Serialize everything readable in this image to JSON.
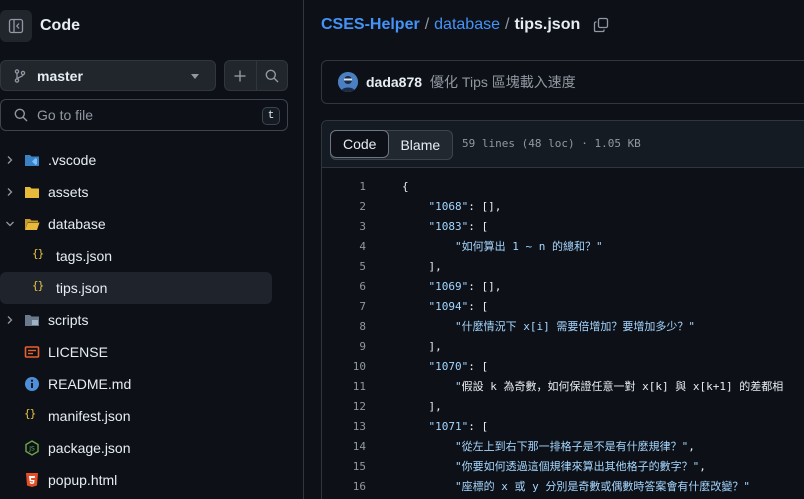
{
  "sidebar": {
    "title": "Code",
    "branch": "master",
    "goto_placeholder": "Go to file",
    "shortcut_key": "t",
    "items": [
      {
        "label": ".vscode",
        "type": "folder",
        "expanded": false,
        "indent": 0,
        "icon": "vscode-folder-icon"
      },
      {
        "label": "assets",
        "type": "folder",
        "expanded": false,
        "indent": 0,
        "icon": "folder-icon"
      },
      {
        "label": "database",
        "type": "folder",
        "expanded": true,
        "indent": 0,
        "icon": "folder-icon"
      },
      {
        "label": "tags.json",
        "type": "file",
        "indent": 1,
        "icon": "json-icon"
      },
      {
        "label": "tips.json",
        "type": "file",
        "indent": 1,
        "icon": "json-icon",
        "selected": true
      },
      {
        "label": "scripts",
        "type": "folder",
        "expanded": false,
        "indent": 0,
        "icon": "scripts-folder-icon"
      },
      {
        "label": "LICENSE",
        "type": "file",
        "indent": 0,
        "icon": "license-icon"
      },
      {
        "label": "README.md",
        "type": "file",
        "indent": 0,
        "icon": "info-icon"
      },
      {
        "label": "manifest.json",
        "type": "file",
        "indent": 0,
        "icon": "json-icon"
      },
      {
        "label": "package.json",
        "type": "file",
        "indent": 0,
        "icon": "node-icon"
      },
      {
        "label": "popup.html",
        "type": "file",
        "indent": 0,
        "icon": "html-icon"
      }
    ]
  },
  "breadcrumb": {
    "repo": "CSES-Helper",
    "folder": "database",
    "file": "tips.json",
    "sep": "/"
  },
  "commit": {
    "author": "dada878",
    "message": "優化 Tips 區塊載入速度"
  },
  "file_view": {
    "tabs": [
      "Code",
      "Blame"
    ],
    "active_tab": "Code",
    "meta": "59 lines (48 loc) · 1.05 KB"
  },
  "code_lines": [
    {
      "n": "1",
      "text": "{"
    },
    {
      "n": "2",
      "text": "    \"1068\": [],"
    },
    {
      "n": "3",
      "text": "    \"1083\": ["
    },
    {
      "n": "4",
      "text": "        \"如何算出 1 ~ n 的總和？\""
    },
    {
      "n": "5",
      "text": "    ],"
    },
    {
      "n": "6",
      "text": "    \"1069\": [],"
    },
    {
      "n": "7",
      "text": "    \"1094\": ["
    },
    {
      "n": "8",
      "text": "        \"什麼情況下 x[i] 需要倍增加？要增加多少？\""
    },
    {
      "n": "9",
      "text": "    ],"
    },
    {
      "n": "10",
      "text": "    \"1070\": ["
    },
    {
      "n": "11",
      "text": "        \"假設 k 為奇數，如何保證任意一對 x[k] 與 x[k+1] 的差都相"
    },
    {
      "n": "12",
      "text": "    ],"
    },
    {
      "n": "13",
      "text": "    \"1071\": ["
    },
    {
      "n": "14",
      "text": "        \"從左上到右下那一排格子是不是有什麼規律？\","
    },
    {
      "n": "15",
      "text": "        \"你要如何透過這個規律來算出其他格子的數字？\","
    },
    {
      "n": "16",
      "text": "        \"座標的 x 或 y 分別是奇數或偶數時答案會有什麼改變？\""
    }
  ],
  "colors": {
    "bg": "#0d1117",
    "link": "#4493f8",
    "json_key": "#a5d6ff",
    "border": "#30363d"
  }
}
